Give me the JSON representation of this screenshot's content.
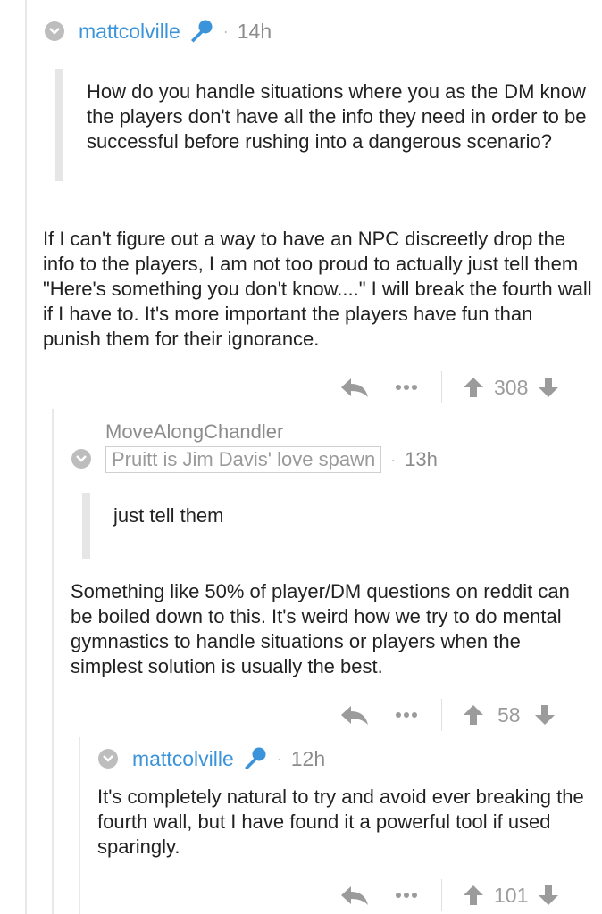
{
  "comments": [
    {
      "author": "mattcolville",
      "time": "14h",
      "quote": "How do you handle situations where you as the DM know the players don't have all the info they need in order to be successful before rushing into a dangerous scenario?",
      "body": "If I can't figure out a way to have an NPC discreetly drop the info to the players, I am not too proud to actually just tell them \"Here's something you don't know....\" I will break the fourth wall if I have to. It's more important the players have fun than punish them for their ignorance.",
      "score": "308"
    },
    {
      "author": "MoveAlongChandler",
      "flair": "Pruitt is Jim Davis' love spawn",
      "time": "13h",
      "quote": "just tell them",
      "body": "Something like 50% of player/DM questions on reddit can be boiled down to this. It's weird how we try to do mental gymnastics to handle situations or players when the simplest solution is usually the best.",
      "score": "58"
    },
    {
      "author": "mattcolville",
      "time": "12h",
      "body": "It's completely natural to try and avoid ever breaking the fourth wall, but I have found it a powerful tool if used sparingly.",
      "score": "101"
    }
  ],
  "separator": "·",
  "icons": {
    "collapse": "collapse-icon",
    "mod": "microphone-icon",
    "reply": "reply-icon",
    "more": "more-icon",
    "upvote": "upvote-icon",
    "downvote": "downvote-icon"
  },
  "colors": {
    "mod_author": "#3b94d9",
    "muted": "#8c8c8c"
  }
}
